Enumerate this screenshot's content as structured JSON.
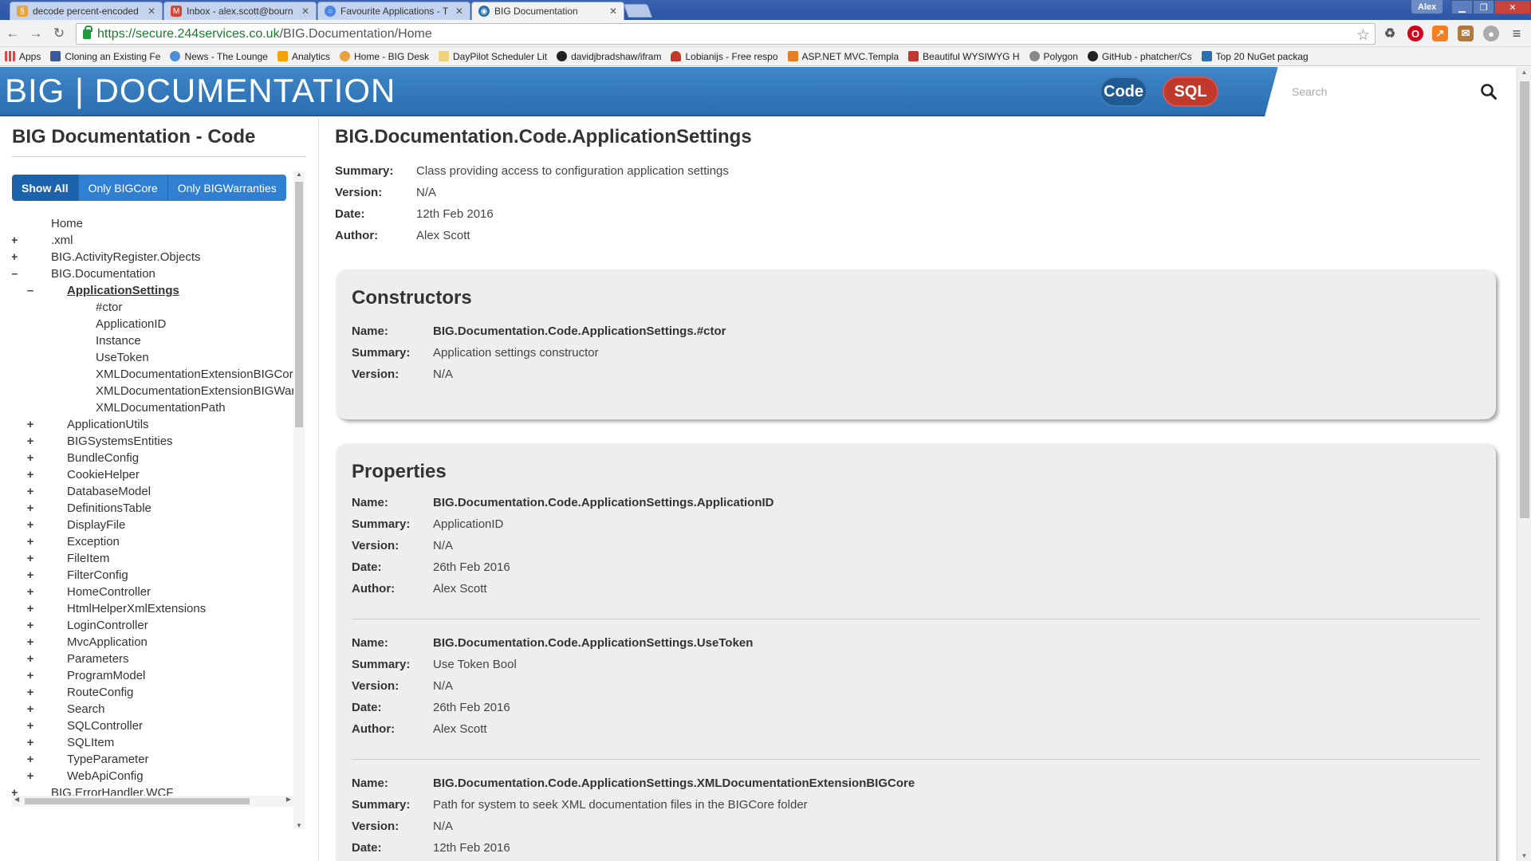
{
  "browser": {
    "tabs": [
      {
        "label": "decode percent-encoded",
        "color": "#e8a33c"
      },
      {
        "label": "Inbox - alex.scott@bourn",
        "color": "#d44638"
      },
      {
        "label": "Favourite Applications - T",
        "color": "#4a86e8"
      },
      {
        "label": "BIG Documentation",
        "color": "#2a6fb0"
      }
    ],
    "profile": "Alex",
    "url_scheme": "https://",
    "url_host": "secure.244services.co.uk",
    "url_path": "/BIG.Documentation/Home",
    "bookmarks": [
      {
        "label": "Apps",
        "color": "#555"
      },
      {
        "label": "Cloning an Existing Fe",
        "color": "#3b5998"
      },
      {
        "label": "News - The Lounge",
        "color": "#4a90d9"
      },
      {
        "label": "Analytics",
        "color": "#f4a300"
      },
      {
        "label": "Home - BIG Desk",
        "color": "#e8a33c"
      },
      {
        "label": "DayPilot Scheduler Lit",
        "color": "#f0d27a"
      },
      {
        "label": "davidjbradshaw/ifram",
        "color": "#222"
      },
      {
        "label": "Lobianijs - Free respo",
        "color": "#c0392b"
      },
      {
        "label": "ASP.NET MVC.Templa",
        "color": "#e67e22"
      },
      {
        "label": "Beautiful WYSIWYG H",
        "color": "#c0392b"
      },
      {
        "label": "Polygon",
        "color": "#888"
      },
      {
        "label": "GitHub - phatcher/Cs",
        "color": "#222"
      },
      {
        "label": "Top 20 NuGet packag",
        "color": "#2a6fb0"
      }
    ]
  },
  "header": {
    "brand": "BIG | DOCUMENTATION",
    "code_button": "Code",
    "sql_button": "SQL",
    "search_placeholder": "Search"
  },
  "sidebar": {
    "title": "BIG Documentation - Code",
    "filters": [
      "Show All",
      "Only BIGCore",
      "Only BIGWarranties"
    ],
    "tree": [
      {
        "label": "Home",
        "depth": 1,
        "toggle": ""
      },
      {
        "label": ".xml",
        "depth": 1,
        "toggle": "+"
      },
      {
        "label": "BIG.ActivityRegister.Objects",
        "depth": 1,
        "toggle": "+"
      },
      {
        "label": "BIG.Documentation",
        "depth": 1,
        "toggle": "–"
      },
      {
        "label": "ApplicationSettings",
        "depth": 2,
        "toggle": "–",
        "current": true
      },
      {
        "label": "#ctor",
        "depth": 3,
        "toggle": ""
      },
      {
        "label": "ApplicationID",
        "depth": 3,
        "toggle": ""
      },
      {
        "label": "Instance",
        "depth": 3,
        "toggle": ""
      },
      {
        "label": "UseToken",
        "depth": 3,
        "toggle": ""
      },
      {
        "label": "XMLDocumentationExtensionBIGCore",
        "depth": 3,
        "toggle": ""
      },
      {
        "label": "XMLDocumentationExtensionBIGWarr",
        "depth": 3,
        "toggle": ""
      },
      {
        "label": "XMLDocumentationPath",
        "depth": 3,
        "toggle": ""
      },
      {
        "label": "ApplicationUtils",
        "depth": 2,
        "toggle": "+"
      },
      {
        "label": "BIGSystemsEntities",
        "depth": 2,
        "toggle": "+"
      },
      {
        "label": "BundleConfig",
        "depth": 2,
        "toggle": "+"
      },
      {
        "label": "CookieHelper",
        "depth": 2,
        "toggle": "+"
      },
      {
        "label": "DatabaseModel",
        "depth": 2,
        "toggle": "+"
      },
      {
        "label": "DefinitionsTable",
        "depth": 2,
        "toggle": "+"
      },
      {
        "label": "DisplayFile",
        "depth": 2,
        "toggle": "+"
      },
      {
        "label": "Exception",
        "depth": 2,
        "toggle": "+"
      },
      {
        "label": "FileItem",
        "depth": 2,
        "toggle": "+"
      },
      {
        "label": "FilterConfig",
        "depth": 2,
        "toggle": "+"
      },
      {
        "label": "HomeController",
        "depth": 2,
        "toggle": "+"
      },
      {
        "label": "HtmlHelperXmlExtensions",
        "depth": 2,
        "toggle": "+"
      },
      {
        "label": "LoginController",
        "depth": 2,
        "toggle": "+"
      },
      {
        "label": "MvcApplication",
        "depth": 2,
        "toggle": "+"
      },
      {
        "label": "Parameters",
        "depth": 2,
        "toggle": "+"
      },
      {
        "label": "ProgramModel",
        "depth": 2,
        "toggle": "+"
      },
      {
        "label": "RouteConfig",
        "depth": 2,
        "toggle": "+"
      },
      {
        "label": "Search",
        "depth": 2,
        "toggle": "+"
      },
      {
        "label": "SQLController",
        "depth": 2,
        "toggle": "+"
      },
      {
        "label": "SQLItem",
        "depth": 2,
        "toggle": "+"
      },
      {
        "label": "TypeParameter",
        "depth": 2,
        "toggle": "+"
      },
      {
        "label": "WebApiConfig",
        "depth": 2,
        "toggle": "+"
      },
      {
        "label": "BIG.ErrorHandler.WCF",
        "depth": 1,
        "toggle": "+"
      }
    ]
  },
  "main": {
    "title": "BIG.Documentation.Code.ApplicationSettings",
    "labels": {
      "name": "Name:",
      "summary": "Summary:",
      "version": "Version:",
      "date": "Date:",
      "author": "Author:"
    },
    "summary": "Class providing access to configuration application settings",
    "version": "N/A",
    "date": "12th Feb 2016",
    "author": "Alex Scott",
    "constructors_heading": "Constructors",
    "constructor": {
      "name": "BIG.Documentation.Code.ApplicationSettings.#ctor",
      "summary": "Application settings constructor",
      "version": "N/A"
    },
    "properties_heading": "Properties",
    "properties": [
      {
        "name": "BIG.Documentation.Code.ApplicationSettings.ApplicationID",
        "summary": "ApplicationID",
        "version": "N/A",
        "date": "26th Feb 2016",
        "author": "Alex Scott"
      },
      {
        "name": "BIG.Documentation.Code.ApplicationSettings.UseToken",
        "summary": "Use Token Bool",
        "version": "N/A",
        "date": "26th Feb 2016",
        "author": "Alex Scott"
      },
      {
        "name": "BIG.Documentation.Code.ApplicationSettings.XMLDocumentationExtensionBIGCore",
        "summary": "Path for system to seek XML documentation files in the BIGCore folder",
        "version": "N/A",
        "date": "12th Feb 2016",
        "author": ""
      }
    ]
  }
}
